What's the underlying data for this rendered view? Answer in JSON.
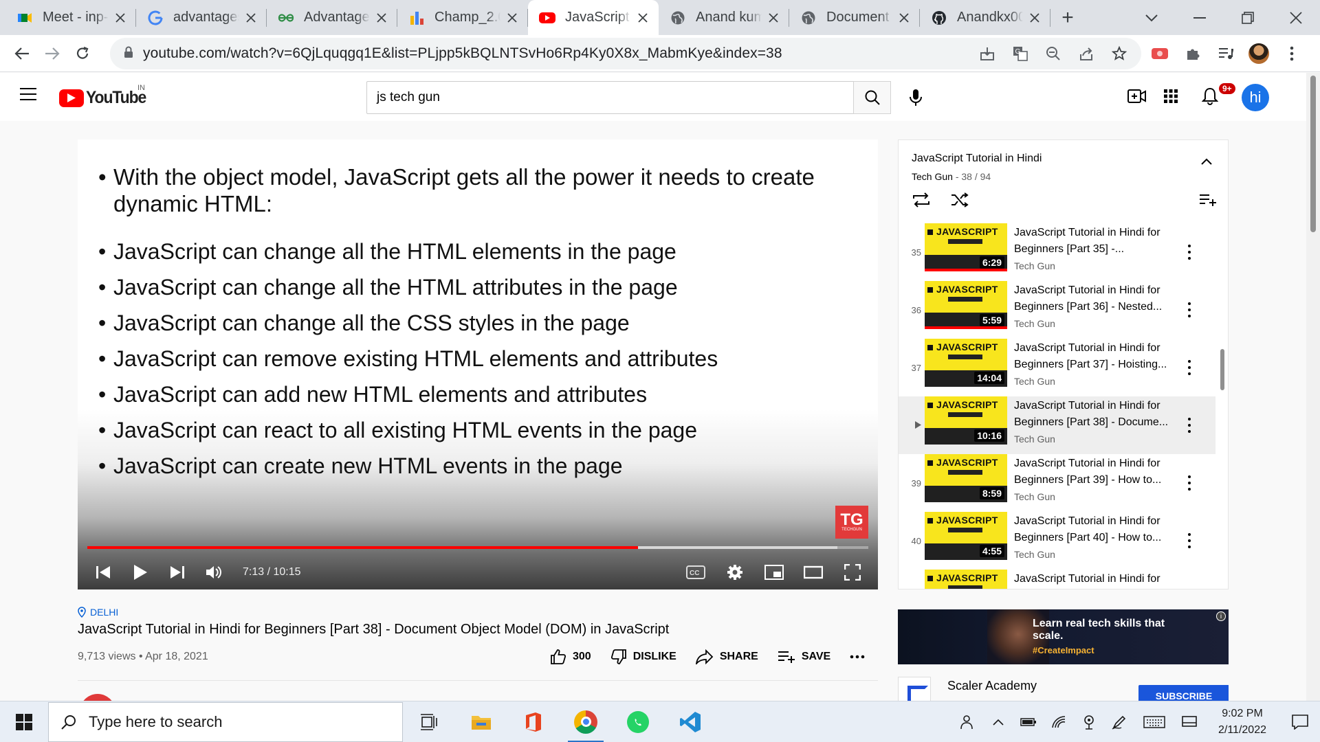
{
  "browser": {
    "tabs": [
      {
        "title": "Meet - inp-",
        "icon": "google-meet-icon"
      },
      {
        "title": "advantages",
        "icon": "google-icon"
      },
      {
        "title": "Advantages",
        "icon": "geeksforgeeks-icon"
      },
      {
        "title": "Champ_2.0",
        "icon": "chart-icon"
      },
      {
        "title": "JavaScript T",
        "icon": "youtube-icon",
        "active": true
      },
      {
        "title": "Anand kum",
        "icon": "globe-icon"
      },
      {
        "title": "Document",
        "icon": "globe-icon"
      },
      {
        "title": "Anandkx00",
        "icon": "github-icon"
      }
    ],
    "url": "youtube.com/watch?v=6QjLquqgq1E&list=PLjpp5kBQLNTSvHo6Rp4Ky0X8x_MabmKye&index=38"
  },
  "youtube": {
    "logo_text": "YouTube",
    "country_code": "IN",
    "search_value": "js tech gun",
    "notification_count": "9+",
    "avatar_letter": "hi",
    "accent": "#ff0000"
  },
  "slide": {
    "intro": "With the object model, JavaScript gets all the power it needs to create dynamic HTML:",
    "bullets": [
      "JavaScript can change all the HTML elements in the page",
      "JavaScript can change all the HTML attributes in the page",
      "JavaScript can change all the CSS styles in the page",
      "JavaScript can remove existing HTML elements and attributes",
      "JavaScript can add new HTML elements and attributes",
      "JavaScript can react to all existing HTML events in the page",
      "JavaScript can create new HTML events in the page"
    ],
    "logo_letters": "TG",
    "logo_sub": "TECHGUN"
  },
  "player": {
    "time_current": "7:13",
    "time_total": "10:15",
    "time_display": "7:13 / 10:15",
    "played_fraction": 0.705,
    "buffered_fraction": 0.96
  },
  "video": {
    "location": "DELHI",
    "title": "JavaScript Tutorial in Hindi for Beginners [Part 38] - Document Object Model (DOM) in JavaScript",
    "meta": "9,713 views • Apr 18, 2021",
    "likes": "300",
    "dislike_label": "DISLIKE",
    "share_label": "SHARE",
    "save_label": "SAVE"
  },
  "playlist": {
    "title": "JavaScript Tutorial in Hindi",
    "channel": "Tech Gun",
    "position": " - 38 / 94",
    "items": [
      {
        "index": "35",
        "title": "JavaScript Tutorial in Hindi for Beginners [Part 35] -...",
        "channel": "Tech Gun",
        "duration": "6:29",
        "watched": true
      },
      {
        "index": "36",
        "title": "JavaScript Tutorial in Hindi for Beginners [Part 36] - Nested...",
        "channel": "Tech Gun",
        "duration": "5:59",
        "watched": true
      },
      {
        "index": "37",
        "title": "JavaScript Tutorial in Hindi for Beginners [Part 37] - Hoisting...",
        "channel": "Tech Gun",
        "duration": "14:04",
        "watched": false
      },
      {
        "index": "▶",
        "title": "JavaScript Tutorial in Hindi for Beginners [Part 38] - Docume...",
        "channel": "Tech Gun",
        "duration": "10:16",
        "watched": false,
        "current": true
      },
      {
        "index": "39",
        "title": "JavaScript Tutorial in Hindi for Beginners [Part 39] - How to...",
        "channel": "Tech Gun",
        "duration": "8:59",
        "watched": false
      },
      {
        "index": "40",
        "title": "JavaScript Tutorial in Hindi for Beginners [Part 40] - How to...",
        "channel": "Tech Gun",
        "duration": "4:55",
        "watched": false
      },
      {
        "index": "",
        "title": "JavaScript Tutorial in Hindi for",
        "channel": "",
        "duration": "",
        "watched": false
      }
    ],
    "thumb_word": "JAVASCRIPT"
  },
  "ad": {
    "headline": "Learn real tech skills that scale.",
    "hashtag": "#CreateImpact",
    "advertiser": "Scaler Academy",
    "cta": "SUBSCRIBE"
  },
  "taskbar": {
    "search_placeholder": "Type here to search",
    "time": "9:02 PM",
    "date": "2/11/2022"
  }
}
